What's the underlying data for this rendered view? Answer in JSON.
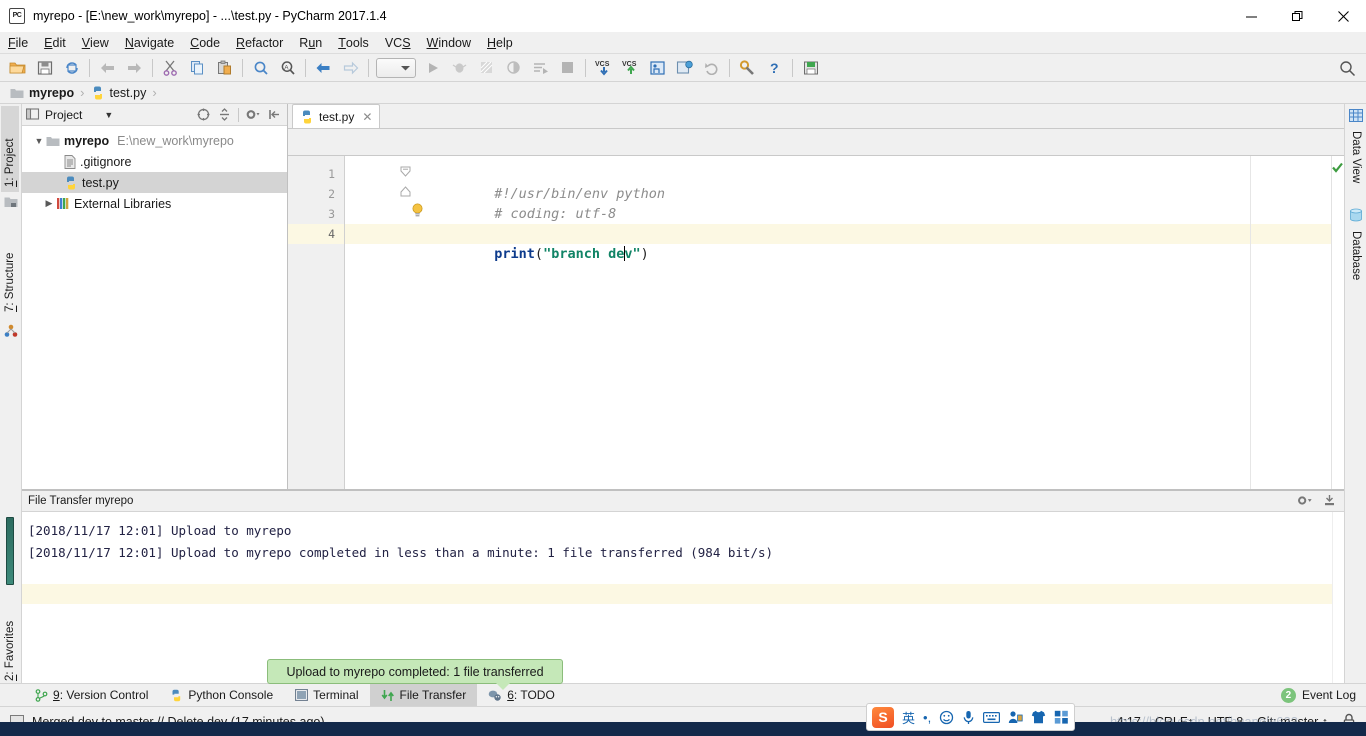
{
  "window": {
    "title": "myrepo - [E:\\new_work\\myrepo] - ...\\test.py - PyCharm 2017.1.4",
    "app_icon": "pycharm-icon",
    "minimize": "—",
    "maximize": "❐",
    "close": "✕"
  },
  "menubar": {
    "items": [
      {
        "label": "File",
        "mnemonic": "F"
      },
      {
        "label": "Edit",
        "mnemonic": "E"
      },
      {
        "label": "View",
        "mnemonic": "V"
      },
      {
        "label": "Navigate",
        "mnemonic": "N"
      },
      {
        "label": "Code",
        "mnemonic": "C"
      },
      {
        "label": "Refactor",
        "mnemonic": "R"
      },
      {
        "label": "Run",
        "mnemonic": "u"
      },
      {
        "label": "Tools",
        "mnemonic": "T"
      },
      {
        "label": "VCS",
        "mnemonic": "S"
      },
      {
        "label": "Window",
        "mnemonic": "W"
      },
      {
        "label": "Help",
        "mnemonic": "H"
      }
    ]
  },
  "toolbar": {
    "buttons": [
      "open-folder-icon",
      "save-all-icon",
      "sync-icon",
      "back-arrow-icon",
      "forward-arrow-icon",
      "cut-icon",
      "copy-icon",
      "paste-icon",
      "find-icon",
      "find-replace-icon",
      "navigate-back-icon",
      "navigate-forward-icon",
      "run-config-dropdown",
      "run-icon",
      "debug-icon",
      "coverage-icon",
      "profile-icon",
      "run-with-console-icon",
      "stop-icon",
      "vcs-update-icon",
      "vcs-commit-icon",
      "vcs-history-icon",
      "settings-sync-icon",
      "rollback-icon",
      "settings-icon",
      "help-icon",
      "database-save-icon"
    ],
    "search_icon": "search-icon"
  },
  "breadcrumb": {
    "items": [
      {
        "label": "myrepo",
        "icon": "folder-icon",
        "bold": true
      },
      {
        "label": "test.py",
        "icon": "python-file-icon",
        "bold": false
      }
    ],
    "separator": "›"
  },
  "left_stripe": {
    "tabs": [
      {
        "label": "1: Project",
        "mnemonic": "1",
        "icon": "project-icon",
        "active": true
      },
      {
        "label": "7: Structure",
        "mnemonic": "7",
        "icon": "structure-icon",
        "active": false
      },
      {
        "label": "2: Favorites",
        "mnemonic": "2",
        "icon": "star-icon",
        "active": false
      }
    ]
  },
  "right_stripe": {
    "tabs": [
      {
        "label": "Data View",
        "icon": "grid-icon"
      },
      {
        "label": "Database",
        "icon": "database-icon"
      }
    ]
  },
  "project_panel": {
    "title": "Project",
    "title_icon": "project-view-icon",
    "caret": "▼",
    "tools": [
      "collapse-target-icon",
      "collapse-all-icon",
      "gear-icon",
      "hide-icon"
    ],
    "tree": [
      {
        "label": "myrepo",
        "sub": "E:\\new_work\\myrepo",
        "icon": "folder-icon",
        "twisty": "▼",
        "indent": 0,
        "bold": true,
        "selected": false
      },
      {
        "label": ".gitignore",
        "sub": "",
        "icon": "text-file-icon",
        "twisty": "",
        "indent": 1,
        "bold": false,
        "selected": false
      },
      {
        "label": "test.py",
        "sub": "",
        "icon": "python-file-icon",
        "twisty": "",
        "indent": 1,
        "bold": false,
        "selected": true
      },
      {
        "label": "External Libraries",
        "sub": "",
        "icon": "libraries-icon",
        "twisty": "▶",
        "indent": 0,
        "bold": false,
        "selected": false
      }
    ]
  },
  "editor": {
    "tabs": [
      {
        "label": "test.py",
        "icon": "python-file-icon",
        "close": "✕",
        "active": true
      }
    ],
    "line_numbers": [
      "1",
      "2",
      "3",
      "4"
    ],
    "lines": [
      {
        "num": "1",
        "type": "comment",
        "text": "#!/usr/bin/env python",
        "fold": "fold-start",
        "current": false
      },
      {
        "num": "2",
        "type": "comment",
        "text": "# coding: utf-8",
        "fold": "fold-end",
        "current": false
      },
      {
        "num": "3",
        "type": "blank",
        "text": "",
        "fold": "",
        "current": false
      },
      {
        "num": "4",
        "type": "code",
        "text": "print(\"branch dev\")",
        "fold": "",
        "current": true
      }
    ],
    "code_line4": {
      "func": "print",
      "open_paren": "(",
      "string_open": "\"",
      "string_before_caret": "branch de",
      "string_after_caret": "v",
      "string_close": "\"",
      "close_paren": ")"
    },
    "bulb_icon": "intention-bulb-icon",
    "inspection_status": "ok-check-icon"
  },
  "file_transfer": {
    "title": "File Transfer myrepo",
    "tools": [
      "gear-dropdown-icon",
      "hide-panel-icon"
    ],
    "log": [
      "[2018/11/17 12:01] Upload to myrepo",
      "[2018/11/17 12:01] Upload to myrepo completed in less than a minute: 1 file transferred (984 bit/s)"
    ]
  },
  "toast": {
    "message": "Upload to myrepo completed: 1 file transferred",
    "background": "#c5e8b8",
    "border": "#8bbd7b"
  },
  "toolwindow_bar": {
    "tabs": [
      {
        "label": "9: Version Control",
        "mnemonic": "9",
        "icon": "version-control-icon",
        "active": false
      },
      {
        "label": "Python Console",
        "mnemonic": "",
        "icon": "python-console-icon",
        "active": false
      },
      {
        "label": "Terminal",
        "mnemonic": "",
        "icon": "terminal-icon",
        "active": false
      },
      {
        "label": "File Transfer",
        "mnemonic": "",
        "icon": "file-transfer-icon",
        "active": true
      },
      {
        "label": "6: TODO",
        "mnemonic": "6",
        "icon": "todo-icon",
        "active": false
      }
    ],
    "event_log": {
      "label": "Event Log",
      "badge": "2",
      "badge_color": "#7cc47c"
    }
  },
  "statusbar": {
    "message": "Merged dev to master // Delete dev (17 minutes ago)",
    "message_icon": "status-window-icon",
    "caret_position": "4:17",
    "line_separator": "CRLF↕",
    "encoding": "UTF-8",
    "branch": "Git: master ↕",
    "lock_icon": "lock-icon",
    "watermark": "https://blog.csdn.net/huangle622"
  },
  "ime": {
    "logo": "S",
    "items": [
      "英",
      "•,",
      "☺",
      "mic-icon",
      "keyboard-icon",
      "user-icon",
      "skin-icon",
      "apps-icon"
    ]
  }
}
